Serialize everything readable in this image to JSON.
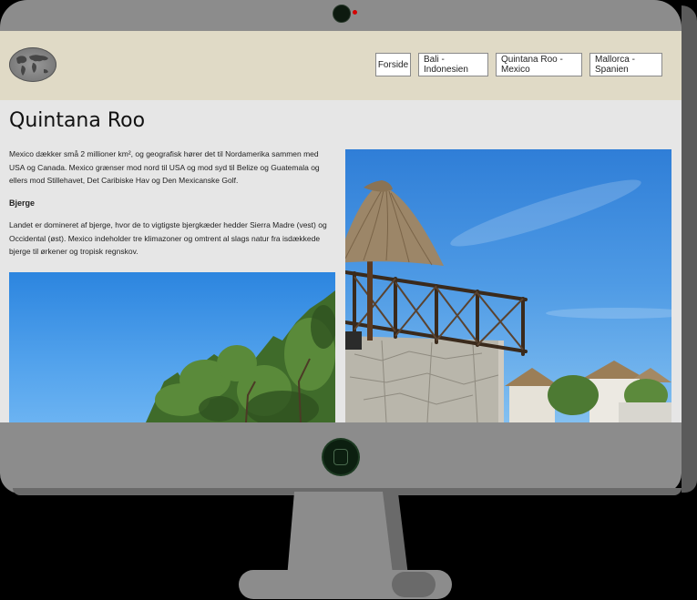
{
  "nav": {
    "items": [
      {
        "label": "Forside"
      },
      {
        "label": "Bali - Indonesien"
      },
      {
        "label": "Quintana Roo - Mexico"
      },
      {
        "label": "Mallorca - Spanien"
      }
    ]
  },
  "page": {
    "title": "Quintana Roo",
    "intro": "Mexico dækker små 2 millioner km², og geografisk hører det til Nordamerika sammen med USA og Canada. Mexico grænser mod nord til USA og mod syd til Belize og Guatemala og ellers mod Stillehavet, Det Caribiske Hav og Den Mexicanske Golf.",
    "section_heading": "Bjerge",
    "section_text": "Landet er domineret af bjerge, hvor de to vigtigste bjergkæder hedder Sierra Madre (vest) og Occidental (øst). Mexico indeholder tre klimazoner og omtrent al slags natur fra isdækkede bjerge til ørkener og tropisk regnskov."
  },
  "colors": {
    "header_bg": "#e0dac6",
    "page_bg": "#e6e6e6",
    "monitor_frame": "#8c8c8c",
    "sky": "#3d8fe2"
  },
  "icons": {
    "logo": "world-map-icon",
    "webcam": "webcam-icon",
    "home_button": "home-button-icon"
  }
}
